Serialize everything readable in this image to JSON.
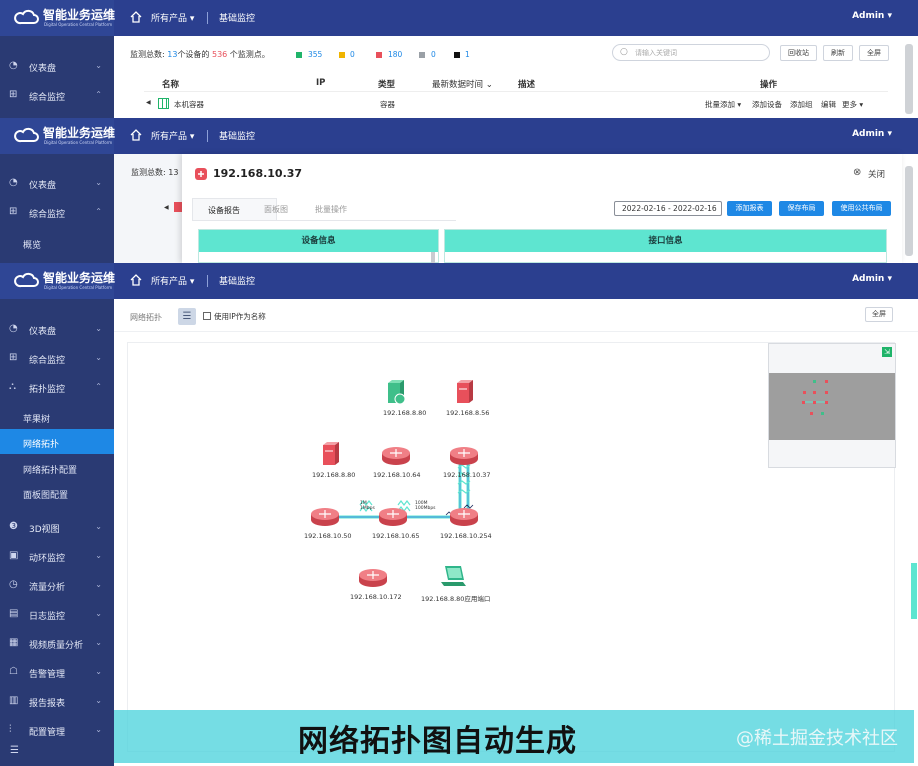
{
  "brand": {
    "name": "智能业务运维",
    "subtitle": "Digital Operation Central Platform"
  },
  "topbar": {
    "products": "所有产品 ▾",
    "monitor": "基础监控",
    "user": "Admin ▾"
  },
  "panel1": {
    "sidebar": [
      {
        "icon": "dashboard-icon",
        "label": "仪表盘",
        "arrow": "⌄"
      },
      {
        "icon": "grid-icon",
        "label": "综合监控",
        "arrow": "⌃"
      }
    ],
    "summary": {
      "prefix": "监测总数: ",
      "devices": "13",
      "mid": "个设备的 ",
      "points": "536",
      "suffix": " 个监测点。"
    },
    "legend": [
      {
        "color": "#20b46a",
        "value": "355"
      },
      {
        "color": "#f0b400",
        "value": "0"
      },
      {
        "color": "#e8505b",
        "value": "180"
      },
      {
        "color": "#9aa0a6",
        "value": "0"
      },
      {
        "color": "#111111",
        "value": "1"
      }
    ],
    "search_placeholder": "请输入关键词",
    "buttons": [
      "回收站",
      "刷新",
      "全屏"
    ],
    "columns": [
      "名称",
      "IP",
      "类型",
      "最新数据时间 ⌄",
      "描述",
      "操作"
    ],
    "row": {
      "name": "本机容器",
      "type": "容器",
      "actions": [
        "批量添加 ▾",
        "添加设备",
        "添加组",
        "编辑",
        "更多 ▾"
      ]
    }
  },
  "panel2": {
    "sidebar": [
      {
        "icon": "dashboard-icon",
        "label": "仪表盘",
        "arrow": "⌄"
      },
      {
        "icon": "grid-icon",
        "label": "综合监控",
        "arrow": "⌃"
      }
    ],
    "sub_overview": "概览",
    "summary_prefix": "监测总数: 13",
    "dialog": {
      "ip": "192.168.10.37",
      "close": "关闭",
      "tabs": [
        "设备报告",
        "面板图",
        "批量操作"
      ],
      "date_range": "2022-02-16 - 2022-02-16",
      "buttons": [
        "添加报表",
        "保存布局",
        "使用公共布局"
      ],
      "sections": [
        "设备信息",
        "接口信息"
      ]
    }
  },
  "panel3": {
    "sidebar": [
      {
        "icon": "dashboard-icon",
        "label": "仪表盘",
        "arrow": "⌄"
      },
      {
        "icon": "grid-icon",
        "label": "综合监控",
        "arrow": "⌄"
      },
      {
        "icon": "topology-icon",
        "label": "拓扑监控",
        "arrow": "⌃"
      }
    ],
    "submenu": [
      "苹果树",
      "网络拓扑",
      "网络拓扑配置",
      "面板图配置"
    ],
    "sidebar_more": [
      {
        "icon": "cube-icon",
        "label": "3D视图",
        "arrow": "⌄"
      },
      {
        "icon": "monitor-icon",
        "label": "动环监控",
        "arrow": "⌄"
      },
      {
        "icon": "gauge-icon",
        "label": "流量分析",
        "arrow": "⌄"
      },
      {
        "icon": "log-icon",
        "label": "日志监控",
        "arrow": "⌄"
      },
      {
        "icon": "video-icon",
        "label": "视频质量分析",
        "arrow": "⌄"
      },
      {
        "icon": "alarm-icon",
        "label": "告警管理",
        "arrow": "⌄"
      },
      {
        "icon": "report-icon",
        "label": "报告报表",
        "arrow": "⌄"
      },
      {
        "icon": "config-icon",
        "label": "配置管理",
        "arrow": "⌄"
      }
    ],
    "toolbar": {
      "title": "网络拓扑",
      "checkbox_label": "使用IP作为名称",
      "fullscreen": "全屏"
    },
    "nodes": [
      {
        "label": "192.168.8.80",
        "kind": "server-ok"
      },
      {
        "label": "192.168.8.56",
        "kind": "server"
      },
      {
        "label": "192.168.8.80",
        "kind": "server"
      },
      {
        "label": "192.168.10.64",
        "kind": "router"
      },
      {
        "label": "192.168.10.37",
        "kind": "router"
      },
      {
        "label": "192.168.10.50",
        "kind": "router"
      },
      {
        "label": "192.168.10.65",
        "kind": "router"
      },
      {
        "label": "192.168.10.254",
        "kind": "router"
      },
      {
        "label": "192.168.10.172",
        "kind": "router"
      },
      {
        "label": "192.168.8.80应用端口",
        "kind": "laptop"
      }
    ],
    "link_labels": [
      "1M\n1Mbps",
      "100M\n100Mbps"
    ]
  },
  "caption": {
    "text": "网络拓扑图自动生成",
    "watermark": "@稀土掘金技术社区"
  },
  "colors": {
    "nav": "#2b3f8f",
    "sidebar": "#2a3a73",
    "accent": "#1e88e5",
    "teal": "#5ee5d0",
    "node_red": "#e8505b"
  }
}
